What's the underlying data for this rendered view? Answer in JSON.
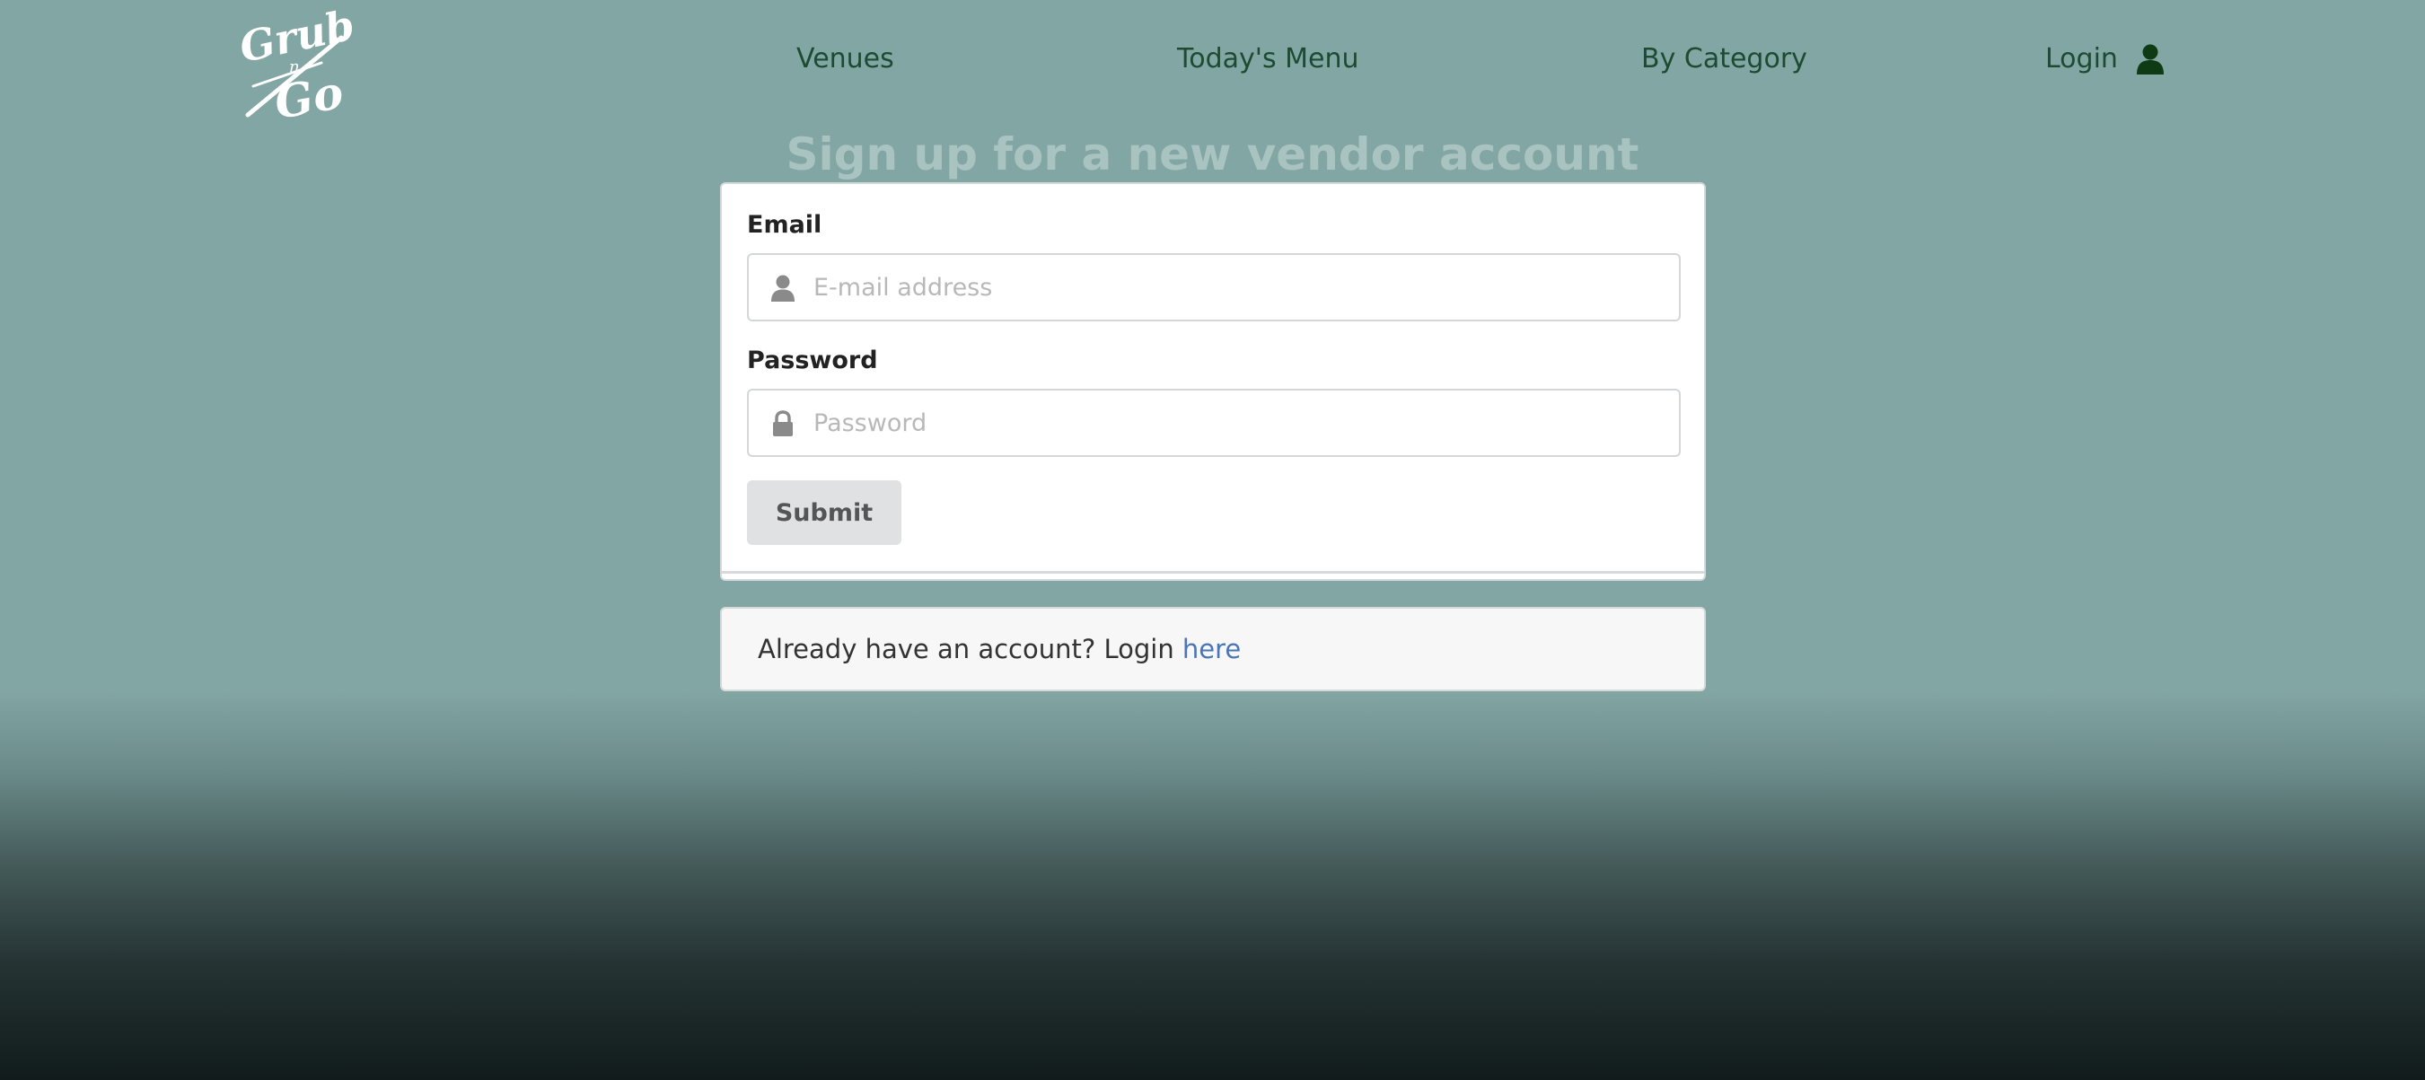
{
  "brand": {
    "logo_text_top": "Grub",
    "logo_text_mid": "n",
    "logo_text_bottom": "Go"
  },
  "nav": {
    "items": [
      {
        "label": "Venues"
      },
      {
        "label": "Today's Menu"
      },
      {
        "label": "By Category"
      }
    ],
    "login_label": "Login",
    "login_icon": "user-icon"
  },
  "page": {
    "title": "Sign up for a new vendor account"
  },
  "form": {
    "email_label": "Email",
    "email_placeholder": "E-mail address",
    "email_value": "",
    "email_icon": "user-icon",
    "password_label": "Password",
    "password_placeholder": "Password",
    "password_value": "",
    "password_icon": "lock-icon",
    "submit_label": "Submit"
  },
  "message": {
    "text": "Already have an account? Login ",
    "link_label": "here"
  },
  "colors": {
    "background_top": "#82a6a4",
    "background_bottom": "#111b1b",
    "nav_text": "#1f4a32",
    "title_text": "#a9c3c1",
    "link": "#4a76b8",
    "button_bg": "#e0e1e2"
  }
}
